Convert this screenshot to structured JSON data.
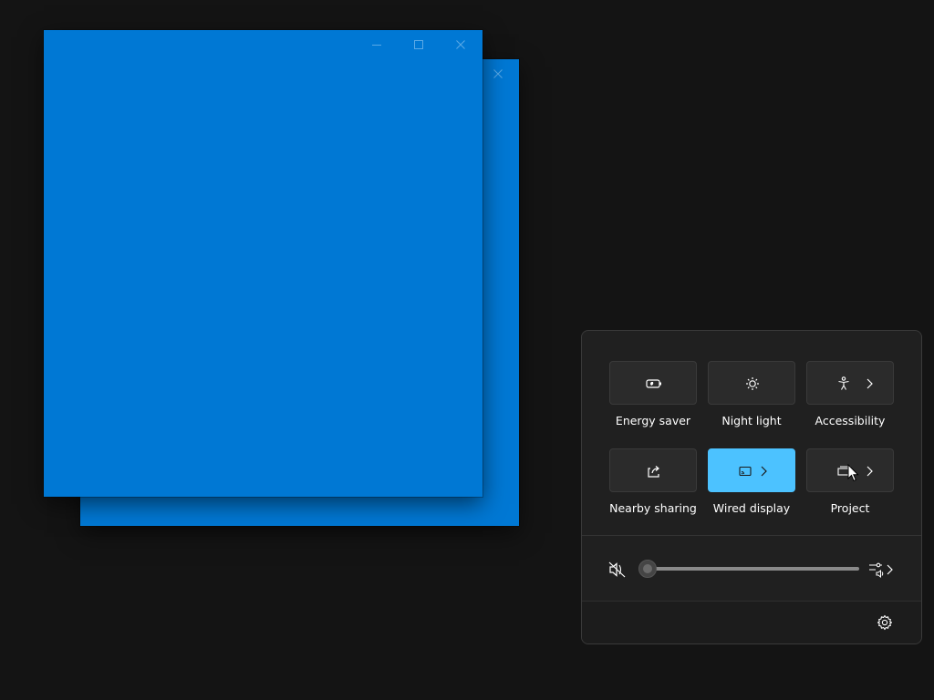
{
  "desktop": {
    "background_color": "#141414"
  },
  "windows": [
    {
      "id": "back-window",
      "color": "#0078d4",
      "caption_buttons": [
        "close-icon"
      ]
    },
    {
      "id": "front-window",
      "color": "#0078d4",
      "caption_buttons": [
        "minimize-icon",
        "maximize-icon",
        "close-icon"
      ]
    }
  ],
  "quick_settings": {
    "tiles": [
      {
        "label": "Energy saver",
        "icon": "energy-saver-icon",
        "active": false,
        "has_chevron": false
      },
      {
        "label": "Night light",
        "icon": "night-light-icon",
        "active": false,
        "has_chevron": false
      },
      {
        "label": "Accessibility",
        "icon": "accessibility-icon",
        "active": false,
        "has_chevron": true
      },
      {
        "label": "Nearby sharing",
        "icon": "share-icon",
        "active": false,
        "has_chevron": false
      },
      {
        "label": "Wired display",
        "icon": "cast-icon",
        "active": true,
        "has_chevron": true
      },
      {
        "label": "Project",
        "icon": "project-icon",
        "active": false,
        "has_chevron": true
      }
    ],
    "volume": {
      "icon": "volume-muted-icon",
      "level": 0,
      "mixer_icon": "sound-mixer-icon"
    },
    "footer": {
      "settings_icon": "gear-icon"
    },
    "accent_color": "#4cc2ff"
  },
  "cursor": {
    "icon": "mouse-pointer-icon"
  }
}
